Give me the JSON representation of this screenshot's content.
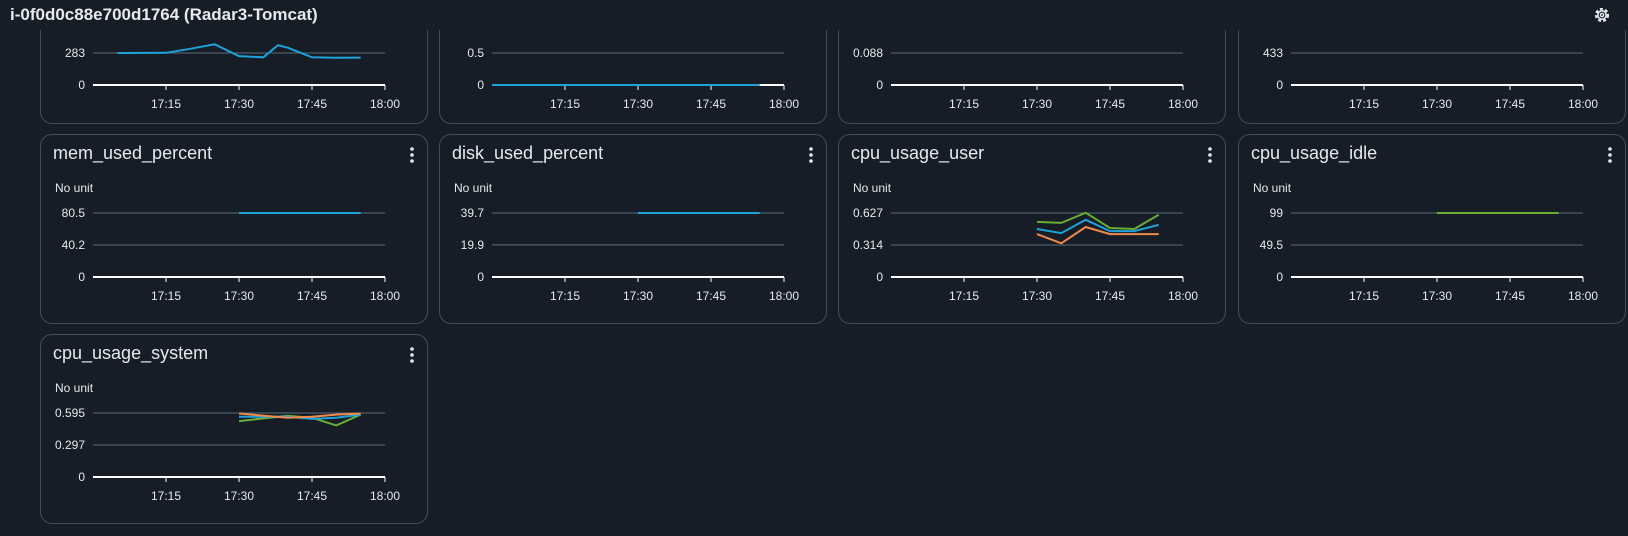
{
  "header": {
    "title": "i-0f0d0c88e700d1764 (Radar3-Tomcat)",
    "settings_icon": "gear-icon"
  },
  "colors": {
    "background": "#161d26",
    "border": "#414d5c",
    "series_blue": "#1ea2d8",
    "series_orange": "#f08a4b",
    "series_green": "#69ae34",
    "grid": "#5f6b7a",
    "axis": "#ffffff"
  },
  "x_ticks": [
    "17:15",
    "17:30",
    "17:45",
    "18:00"
  ],
  "cards": [
    {
      "id": "partial-1",
      "title": "",
      "unit": "",
      "partial": true,
      "y_ticks": [
        "283",
        "0"
      ],
      "chart_data": {
        "type": "line",
        "x_ticks": [
          "17:15",
          "17:30",
          "17:45",
          "18:00"
        ],
        "yticks": [
          283,
          0
        ],
        "series": [
          {
            "color": "#1ea2d8",
            "points": [
              [
                "17:05",
                283
              ],
              [
                "17:15",
                285
              ],
              [
                "17:20",
                320
              ],
              [
                "17:25",
                360
              ],
              [
                "17:30",
                256
              ],
              [
                "17:35",
                245
              ],
              [
                "17:38",
                352
              ],
              [
                "17:40",
                330
              ],
              [
                "17:45",
                245
              ],
              [
                "17:50",
                241
              ],
              [
                "17:55",
                242
              ]
            ]
          }
        ]
      }
    },
    {
      "id": "partial-2",
      "title": "",
      "unit": "",
      "partial": true,
      "y_ticks": [
        "0.5",
        "0"
      ],
      "chart_data": {
        "type": "line",
        "x_ticks": [
          "17:15",
          "17:30",
          "17:45",
          "18:00"
        ],
        "yticks": [
          0.5,
          0
        ],
        "series": [
          {
            "color": "#1ea2d8",
            "points": [
              [
                "17:00",
                0
              ],
              [
                "17:55",
                0
              ]
            ]
          }
        ]
      }
    },
    {
      "id": "partial-3",
      "title": "",
      "unit": "",
      "partial": true,
      "y_ticks": [
        "0.088",
        "0"
      ],
      "chart_data": {
        "type": "line",
        "x_ticks": [
          "17:15",
          "17:30",
          "17:45",
          "18:00"
        ],
        "yticks": [
          0.088,
          0
        ],
        "series": []
      }
    },
    {
      "id": "partial-4",
      "title": "",
      "unit": "",
      "partial": true,
      "y_ticks": [
        "433",
        "0"
      ],
      "chart_data": {
        "type": "line",
        "x_ticks": [
          "17:15",
          "17:30",
          "17:45",
          "18:00"
        ],
        "yticks": [
          433,
          0
        ],
        "series": []
      }
    },
    {
      "id": "mem_used_percent",
      "title": "mem_used_percent",
      "unit": "No unit",
      "partial": false,
      "y_ticks": [
        "80.5",
        "40.2",
        "0"
      ],
      "chart_data": {
        "type": "line",
        "x_ticks": [
          "17:15",
          "17:30",
          "17:45",
          "18:00"
        ],
        "yticks": [
          80.5,
          40.2,
          0
        ],
        "series": [
          {
            "color": "#1ea2d8",
            "points": [
              [
                "17:30",
                80.5
              ],
              [
                "17:55",
                80.5
              ]
            ]
          }
        ]
      }
    },
    {
      "id": "disk_used_percent",
      "title": "disk_used_percent",
      "unit": "No unit",
      "partial": false,
      "y_ticks": [
        "39.7",
        "19.9",
        "0"
      ],
      "chart_data": {
        "type": "line",
        "x_ticks": [
          "17:15",
          "17:30",
          "17:45",
          "18:00"
        ],
        "yticks": [
          39.7,
          19.9,
          0
        ],
        "series": [
          {
            "color": "#1ea2d8",
            "points": [
              [
                "17:30",
                39.7
              ],
              [
                "17:55",
                39.7
              ]
            ]
          }
        ]
      }
    },
    {
      "id": "cpu_usage_user",
      "title": "cpu_usage_user",
      "unit": "No unit",
      "partial": false,
      "y_ticks": [
        "0.627",
        "0.314",
        "0"
      ],
      "chart_data": {
        "type": "line",
        "x_ticks": [
          "17:15",
          "17:30",
          "17:45",
          "18:00"
        ],
        "yticks": [
          0.627,
          0.314,
          0
        ],
        "series": [
          {
            "color": "#69ae34",
            "points": [
              [
                "17:30",
                0.54
              ],
              [
                "17:35",
                0.53
              ],
              [
                "17:40",
                0.63
              ],
              [
                "17:45",
                0.48
              ],
              [
                "17:50",
                0.47
              ],
              [
                "17:55",
                0.61
              ]
            ]
          },
          {
            "color": "#1ea2d8",
            "points": [
              [
                "17:30",
                0.47
              ],
              [
                "17:35",
                0.43
              ],
              [
                "17:40",
                0.56
              ],
              [
                "17:45",
                0.45
              ],
              [
                "17:50",
                0.45
              ],
              [
                "17:55",
                0.51
              ]
            ]
          },
          {
            "color": "#f08a4b",
            "points": [
              [
                "17:30",
                0.42
              ],
              [
                "17:35",
                0.33
              ],
              [
                "17:40",
                0.49
              ],
              [
                "17:45",
                0.42
              ],
              [
                "17:50",
                0.42
              ],
              [
                "17:55",
                0.42
              ]
            ]
          }
        ]
      }
    },
    {
      "id": "cpu_usage_idle",
      "title": "cpu_usage_idle",
      "unit": "No unit",
      "partial": false,
      "y_ticks": [
        "99",
        "49.5",
        "0"
      ],
      "chart_data": {
        "type": "line",
        "x_ticks": [
          "17:15",
          "17:30",
          "17:45",
          "18:00"
        ],
        "yticks": [
          99,
          49.5,
          0
        ],
        "series": [
          {
            "color": "#69ae34",
            "points": [
              [
                "17:30",
                99
              ],
              [
                "17:55",
                99
              ]
            ]
          }
        ]
      }
    },
    {
      "id": "cpu_usage_system",
      "title": "cpu_usage_system",
      "unit": "No unit",
      "partial": false,
      "y_ticks": [
        "0.595",
        "0.297",
        "0"
      ],
      "chart_data": {
        "type": "line",
        "x_ticks": [
          "17:15",
          "17:30",
          "17:45",
          "18:00"
        ],
        "yticks": [
          0.595,
          0.297,
          0
        ],
        "series": [
          {
            "color": "#69ae34",
            "points": [
              [
                "17:30",
                0.52
              ],
              [
                "17:40",
                0.57
              ],
              [
                "17:45",
                0.55
              ],
              [
                "17:50",
                0.48
              ],
              [
                "17:55",
                0.58
              ]
            ]
          },
          {
            "color": "#1ea2d8",
            "points": [
              [
                "17:30",
                0.56
              ],
              [
                "17:40",
                0.56
              ],
              [
                "17:45",
                0.54
              ],
              [
                "17:50",
                0.55
              ],
              [
                "17:55",
                0.58
              ]
            ]
          },
          {
            "color": "#f08a4b",
            "points": [
              [
                "17:30",
                0.59
              ],
              [
                "17:40",
                0.55
              ],
              [
                "17:45",
                0.56
              ],
              [
                "17:50",
                0.58
              ],
              [
                "17:55",
                0.59
              ]
            ]
          }
        ]
      }
    }
  ]
}
